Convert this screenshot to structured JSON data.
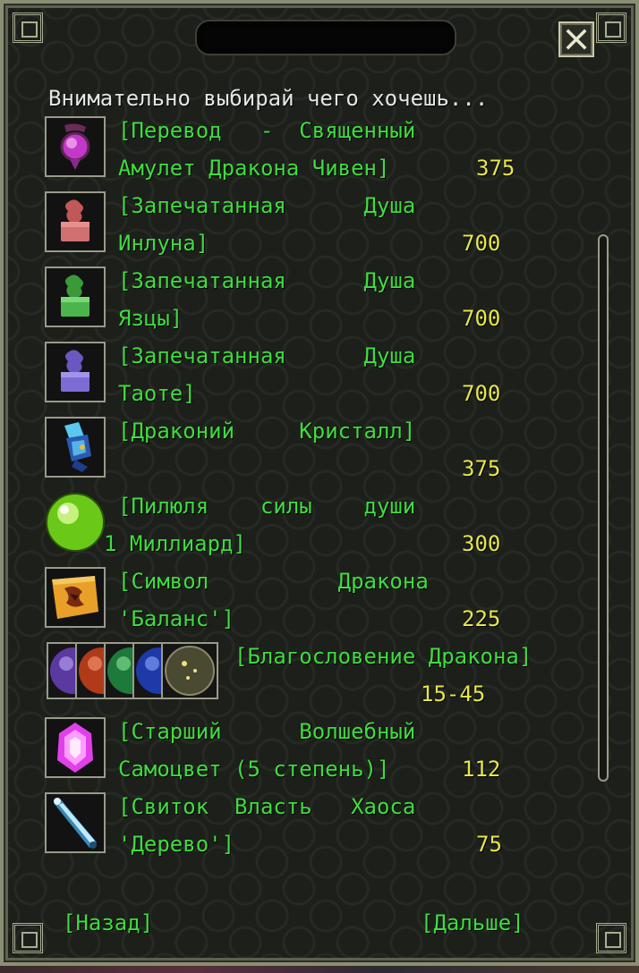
{
  "dialog": {
    "prompt": "Внимательно выбирай чего хочешь...",
    "close_icon": "close-icon"
  },
  "items": [
    {
      "name_line1": "[Перевод   -  Священный",
      "name_line2": "Амулет Дракона Чивен]",
      "price": "375",
      "icon": "amulet-icon"
    },
    {
      "name_line1": "[Запечатанная      Душа",
      "name_line2": "Инлуна]",
      "price": "700",
      "icon": "red-seal-icon"
    },
    {
      "name_line1": "[Запечатанная      Душа",
      "name_line2": "Язцы]",
      "price": "700",
      "icon": "green-seal-icon"
    },
    {
      "name_line1": "[Запечатанная      Душа",
      "name_line2": "Таоте]",
      "price": "700",
      "icon": "purple-seal-icon"
    },
    {
      "name_line1": "[Драконий     Кристалл]",
      "name_line2": "",
      "price": "375",
      "icon": "crystal-icon"
    },
    {
      "name_line1": "[Пилюля    силы    души",
      "name_line2": "1 Миллиард]",
      "price": "300",
      "icon": "pill-icon"
    },
    {
      "name_line1": "[Символ          Дракона",
      "name_line2": "'Баланс']",
      "price": "225",
      "icon": "scroll-symbol-icon"
    },
    {
      "name_line1": "[Благословение Дракона]",
      "name_line2": "",
      "price": "15-45",
      "icon": "dragon-orbs-icon"
    },
    {
      "name_line1": "[Старший      Волшебный",
      "name_line2": "Самоцвет (5 степень)]",
      "price": "112",
      "icon": "gem-icon"
    },
    {
      "name_line1": "[Свиток  Власть   Хаоса",
      "name_line2": "'Дерево']",
      "price": "75",
      "icon": "chaos-scroll-icon"
    }
  ],
  "nav": {
    "back_label": "[Назад]",
    "next_label": "[Дальше]"
  },
  "colors": {
    "item_text": "#3fdc3f",
    "price_text": "#e6e64a",
    "prompt_text": "#e6e6e6"
  }
}
